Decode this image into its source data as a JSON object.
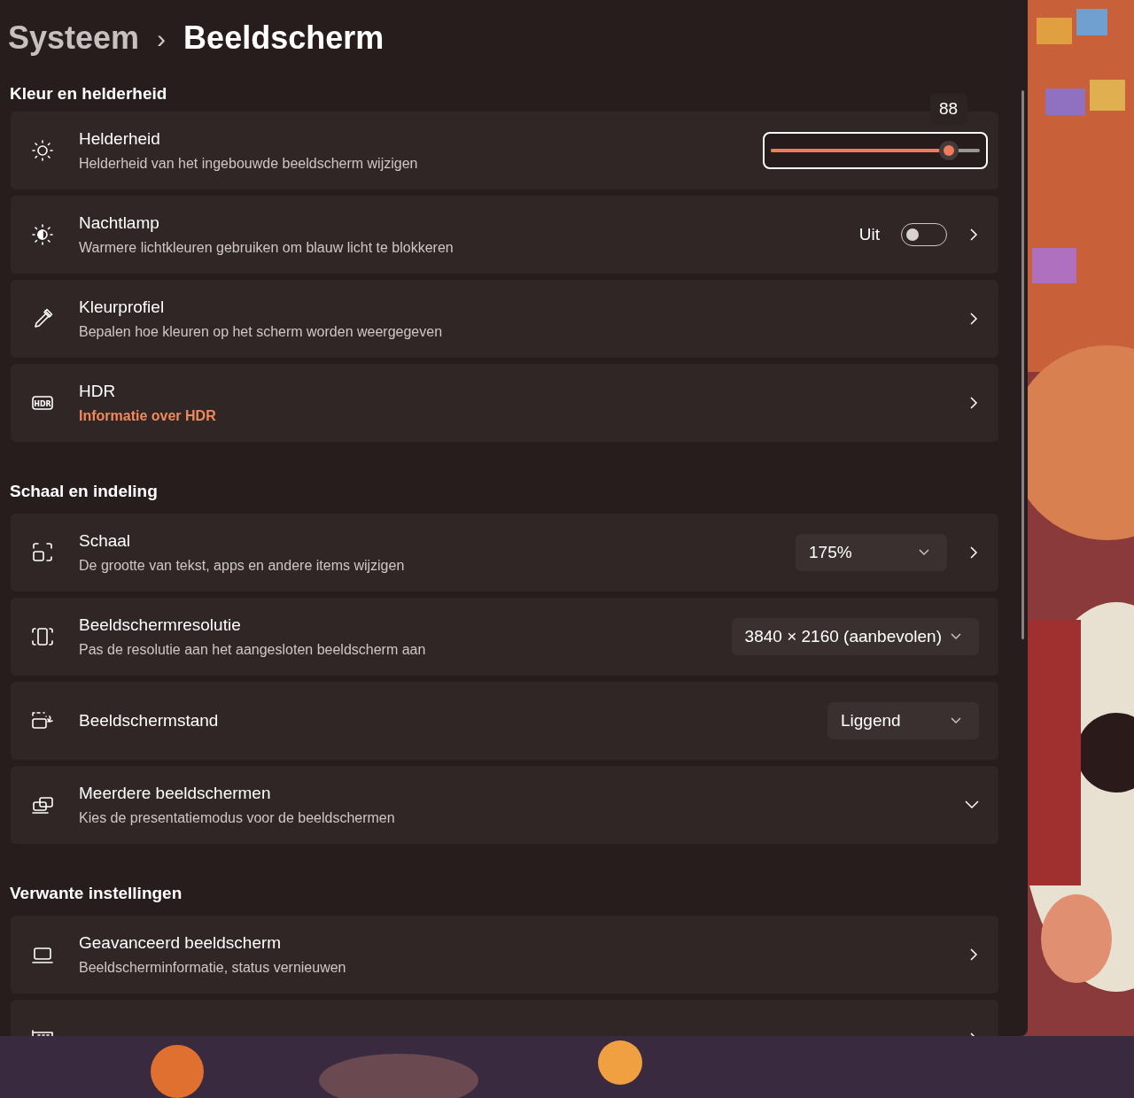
{
  "breadcrumb": {
    "parent": "Systeem",
    "separator": "›",
    "current": "Beeldscherm"
  },
  "sections": [
    {
      "heading": "Kleur en helderheid",
      "rows": [
        {
          "kind": "slider",
          "title": "Helderheid",
          "subtitle": "Helderheid van het ingebouwde beeldscherm wijzigen",
          "level": 0.85,
          "tooltip": "88",
          "chevron": false,
          "expandable": false
        },
        {
          "kind": "toggle",
          "title": "Nachtlamp",
          "subtitle": "Warmere lichtkleuren gebruiken om blauw licht te blokkeren",
          "state_label": "Uit",
          "on": false,
          "chevron": true,
          "expandable": false
        },
        {
          "kind": "link",
          "title": "Kleurprofiel",
          "subtitle": "Bepalen hoe kleuren op het scherm worden weergegeven",
          "chevron": true,
          "expandable": false
        },
        {
          "kind": "link",
          "title": "HDR",
          "icon_label": "HDR",
          "link": "Informatie over HDR",
          "chevron": true,
          "expandable": false
        }
      ]
    },
    {
      "heading": "Schaal en indeling",
      "rows": [
        {
          "kind": "dropdown",
          "title": "Schaal",
          "subtitle": "De grootte van tekst, apps en andere items wijzigen",
          "value": "175%",
          "chevron": true,
          "expandable": false
        },
        {
          "kind": "dropdown",
          "title": "Beeldschermresolutie",
          "subtitle": "Pas de resolutie aan het aangesloten beeldscherm aan",
          "value": "3840 × 2160 (aanbevolen)",
          "chevron": false,
          "expandable": false
        },
        {
          "kind": "dropdown",
          "title": "Beeldschermstand",
          "value": "Liggend",
          "chevron": false,
          "expandable": false
        },
        {
          "kind": "link",
          "title": "Meerdere beeldschermen",
          "subtitle": "Kies de presentatiemodus voor de beeldschermen",
          "chevron": false,
          "expandable": true
        }
      ]
    },
    {
      "heading": "Verwante instellingen",
      "rows": [
        {
          "kind": "link",
          "title": "Geavanceerd beeldscherm",
          "subtitle": "Beeldscherminformatie, status vernieuwen",
          "chevron": true,
          "expandable": false
        },
        {
          "kind": "link",
          "chevron": true,
          "expandable": false
        }
      ]
    }
  ]
}
